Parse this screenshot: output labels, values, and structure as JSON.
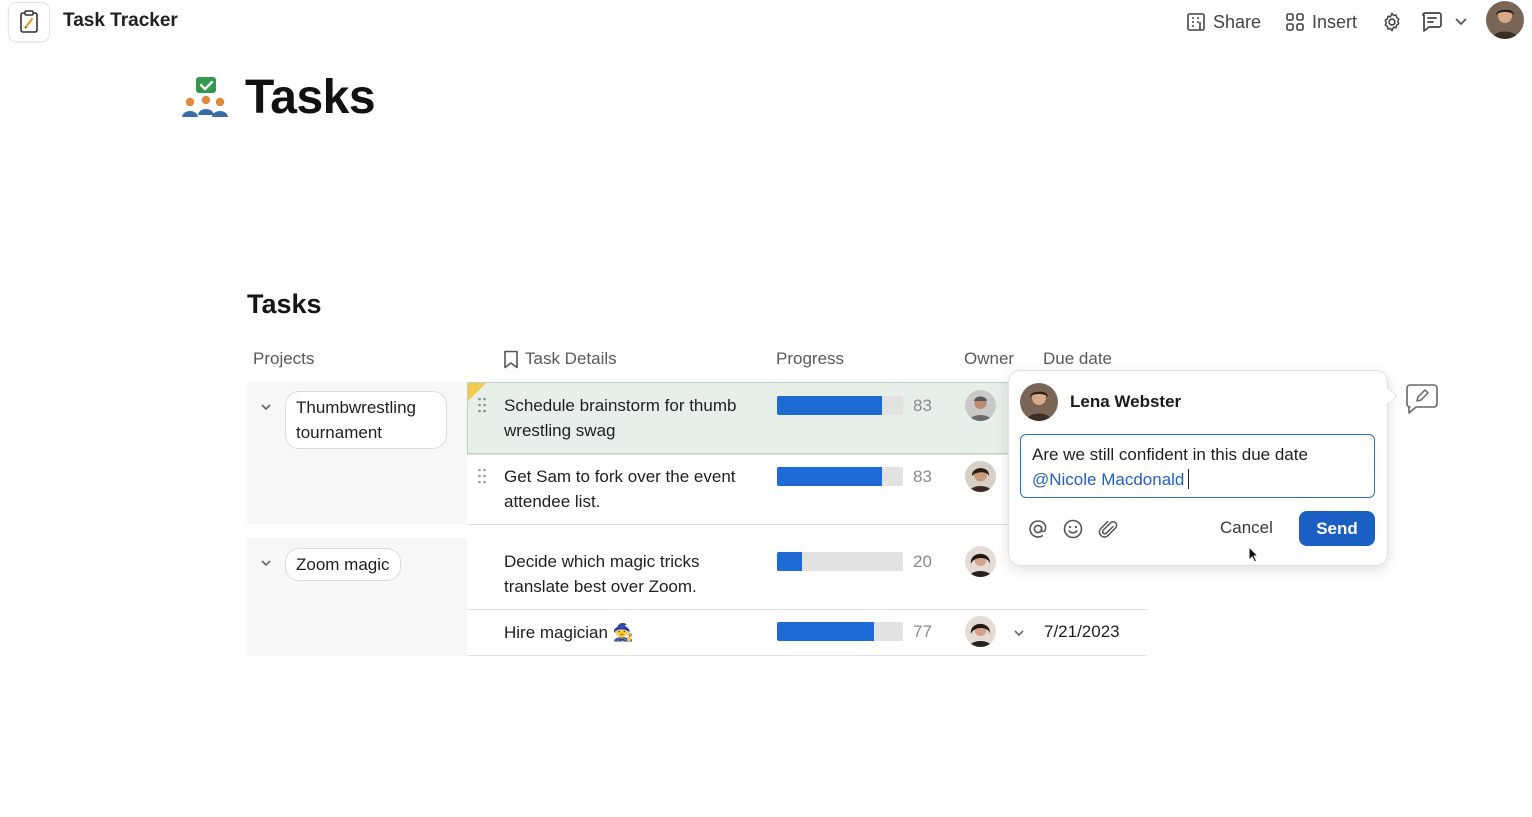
{
  "app": {
    "title": "Task Tracker",
    "icon": "clipboard-icon"
  },
  "toolbar": {
    "share_label": "Share",
    "insert_label": "Insert"
  },
  "page": {
    "title": "Tasks",
    "section_title": "Tasks"
  },
  "table": {
    "columns": [
      "Projects",
      "Task Details",
      "Progress",
      "Owner",
      "Due date"
    ],
    "groups": [
      {
        "project": "Thumbwrestling tournament",
        "tasks": [
          {
            "text": "Schedule brainstorm for thumb wrestling swag",
            "progress": 83,
            "progress_label": "83",
            "selected": true
          },
          {
            "text": "Get Sam to fork over the event attendee list.",
            "progress": 83,
            "progress_label": "83"
          }
        ]
      },
      {
        "project": "Zoom magic",
        "tasks": [
          {
            "text": "Decide which magic tricks translate best over Zoom.",
            "progress": 20,
            "progress_label": "20"
          },
          {
            "text": "Hire magician 🧙",
            "progress": 77,
            "progress_label": "77",
            "due": "7/21/2023"
          }
        ]
      }
    ]
  },
  "comment": {
    "author": "Lena Webster",
    "text": "Are we still confident in this due date",
    "mention": "@Nicole Macdonald",
    "cancel_label": "Cancel",
    "send_label": "Send"
  },
  "colors": {
    "accent": "#1a5fc4",
    "progress_fill": "#1f6bd6",
    "selected_row": "#e7efe9",
    "mention": "#1f5fc9"
  }
}
